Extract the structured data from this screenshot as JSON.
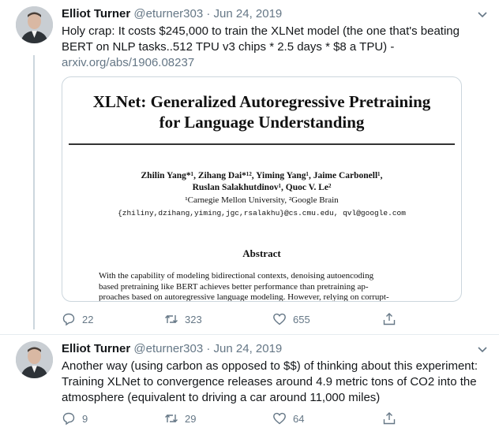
{
  "tweets": [
    {
      "name": "Elliot Turner",
      "handle": "@eturner303",
      "separator": "·",
      "date": "Jun 24, 2019",
      "text": "Holy crap: It costs $245,000 to train the XLNet model (the one that's beating BERT on NLP tasks..512 TPU v3 chips * 2.5 days * $8 a TPU) -",
      "link": "arxiv.org/abs/1906.08237",
      "replies": "22",
      "retweets": "323",
      "likes": "655"
    },
    {
      "name": "Elliot Turner",
      "handle": "@eturner303",
      "separator": "·",
      "date": "Jun 24, 2019",
      "text": "Another way (using carbon as opposed to $$) of thinking about this experiment:  Training XLNet to convergence releases around 4.9 metric tons of CO2 into the atmosphere (equivalent to driving a car around 11,000 miles)",
      "replies": "9",
      "retweets": "29",
      "likes": "64"
    }
  ],
  "paper": {
    "title_line1": "XLNet: Generalized Autoregressive Pretraining",
    "title_line2": "for Language Understanding",
    "authors_line1": "Zhilin Yang*¹, Zihang Dai*¹², Yiming Yang¹, Jaime Carbonell¹,",
    "authors_line2": "Ruslan Salakhutdinov¹, Quoc V. Le²",
    "affiliations": "¹Carnegie Mellon University, ²Google Brain",
    "emails": "{zhiliny,dzihang,yiming,jgc,rsalakhu}@cs.cmu.edu, qvl@google.com",
    "abstract_heading": "Abstract",
    "abstract_line1": "With the capability of modeling bidirectional contexts, denoising autoencoding",
    "abstract_line2": "based pretraining like BERT achieves better performance than pretraining ap-",
    "abstract_line3": "proaches based on autoregressive language modeling. However, relying on corrupt-"
  },
  "colors": {
    "text": "#14171a",
    "muted": "#657786",
    "border": "#ccd6dd"
  },
  "icons": [
    "caret-down-icon",
    "reply-icon",
    "retweet-icon",
    "like-icon",
    "share-icon"
  ]
}
